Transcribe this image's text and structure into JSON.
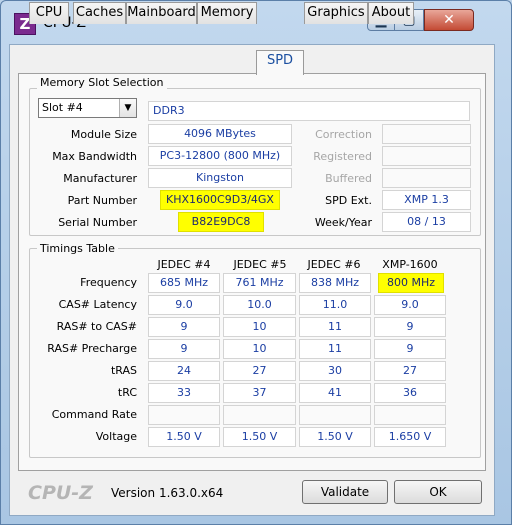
{
  "window": {
    "title": "CPU-Z",
    "app_icon_letter": "Z",
    "minimize": "▁",
    "maximize": "▢",
    "close": "✕"
  },
  "tabs": [
    "CPU",
    "Caches",
    "Mainboard",
    "Memory",
    "SPD",
    "Graphics",
    "About"
  ],
  "active_tab": "SPD",
  "slot": {
    "legend": "Memory Slot Selection",
    "selected": "Slot #4",
    "type": "DDR3",
    "module_size_label": "Module Size",
    "module_size": "4096 MBytes",
    "max_bandwidth_label": "Max Bandwidth",
    "max_bandwidth": "PC3-12800 (800 MHz)",
    "manufacturer_label": "Manufacturer",
    "manufacturer": "Kingston",
    "part_number_label": "Part Number",
    "part_number": "KHX1600C9D3/4GX",
    "serial_number_label": "Serial Number",
    "serial_number": "B82E9DC8",
    "correction_label": "Correction",
    "registered_label": "Registered",
    "buffered_label": "Buffered",
    "spd_ext_label": "SPD Ext.",
    "spd_ext": "XMP 1.3",
    "week_year_label": "Week/Year",
    "week_year": "08 / 13"
  },
  "timings": {
    "legend": "Timings Table",
    "columns": [
      "JEDEC #4",
      "JEDEC #5",
      "JEDEC #6",
      "XMP-1600"
    ],
    "rows": [
      {
        "label": "Frequency",
        "values": [
          "685 MHz",
          "761 MHz",
          "838 MHz",
          "800 MHz"
        ]
      },
      {
        "label": "CAS# Latency",
        "values": [
          "9.0",
          "10.0",
          "11.0",
          "9.0"
        ]
      },
      {
        "label": "RAS# to CAS#",
        "values": [
          "9",
          "10",
          "11",
          "9"
        ]
      },
      {
        "label": "RAS# Precharge",
        "values": [
          "9",
          "10",
          "11",
          "9"
        ]
      },
      {
        "label": "tRAS",
        "values": [
          "24",
          "27",
          "30",
          "27"
        ]
      },
      {
        "label": "tRC",
        "values": [
          "33",
          "37",
          "41",
          "36"
        ]
      },
      {
        "label": "Command Rate",
        "values": [
          "",
          "",
          "",
          ""
        ]
      },
      {
        "label": "Voltage",
        "values": [
          "1.50 V",
          "1.50 V",
          "1.50 V",
          "1.650 V"
        ]
      }
    ]
  },
  "footer": {
    "brand": "CPU-Z",
    "version": "Version 1.63.0.x64",
    "validate": "Validate",
    "ok": "OK"
  },
  "colors": {
    "highlight": "#ffff00",
    "value_text": "#1b3ea3"
  }
}
